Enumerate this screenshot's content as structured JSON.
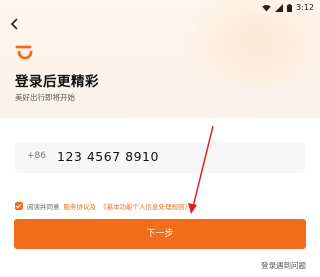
{
  "status_bar": {
    "time": "3:12"
  },
  "header": {
    "title": "登录后更精彩",
    "subtitle": "美好出行即将开始"
  },
  "phone_input": {
    "country_code": "+86",
    "value": "123 4567 8910"
  },
  "agreement": {
    "prefix": "阅读并同意",
    "service_link": "服务协议及",
    "privacy_link": "《基本功能个人信息处理规则》"
  },
  "next_button": {
    "label": "下一步"
  },
  "help_link": {
    "label": "登录遇到问题"
  },
  "colors": {
    "accent": "#f26d1b"
  },
  "icons": [
    "back-arrow-icon",
    "app-logo-icon",
    "wifi-icon",
    "signal-icon",
    "battery-icon",
    "checkbox-checked-icon"
  ]
}
